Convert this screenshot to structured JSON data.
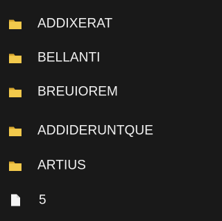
{
  "explorer": {
    "items": [
      {
        "name": "ADDIXERAT",
        "type": "folder",
        "icon": "folder-icon"
      },
      {
        "name": "BELLANTI",
        "type": "folder",
        "icon": "folder-icon"
      },
      {
        "name": "BREUIOREM",
        "type": "folder",
        "icon": "folder-icon"
      },
      {
        "name": "ADDIDERUNTQUE",
        "type": "folder",
        "icon": "folder-icon"
      },
      {
        "name": "ARTIUS",
        "type": "folder",
        "icon": "folder-icon"
      },
      {
        "name": "5",
        "type": "file",
        "icon": "file-icon"
      }
    ],
    "colors": {
      "background": "#191919",
      "text": "#f1f1f1",
      "folder_front": "#f2c94c",
      "folder_back": "#d8a72f",
      "file_fill": "#f5f5f5",
      "file_fold": "#d8d8d8"
    }
  }
}
